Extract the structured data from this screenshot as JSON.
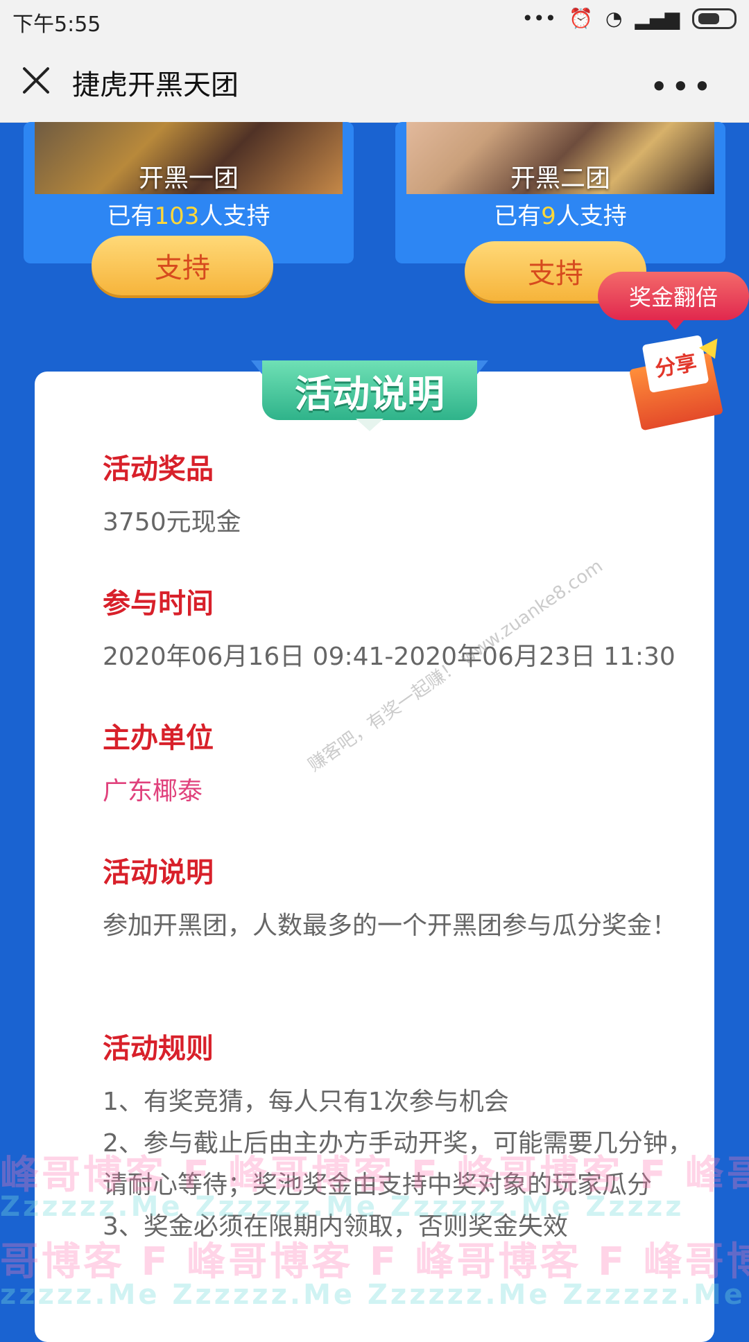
{
  "status_bar": {
    "time": "下午5:55",
    "icons": [
      "more-dots-icon",
      "alarm-icon",
      "wifi-icon",
      "hd-signal-icon",
      "battery-icon"
    ]
  },
  "header": {
    "title": "捷虎开黑天团",
    "close_icon": "close-icon",
    "more_icon": "more-icon"
  },
  "teams": [
    {
      "name": "开黑一团",
      "support_prefix": "已有",
      "count": "103",
      "support_suffix": "人支持",
      "button": "支持"
    },
    {
      "name": "开黑二团",
      "support_prefix": "已有",
      "count": "9",
      "support_suffix": "人支持",
      "button": "支持"
    }
  ],
  "bonus_badge": "奖金翻倍",
  "share_label": "分享",
  "banner": "活动说明",
  "sections": {
    "prize": {
      "title": "活动奖品",
      "body": "3750元现金"
    },
    "time": {
      "title": "参与时间",
      "body": "2020年06月16日 09:41-2020年06月23日 11:30"
    },
    "organizer": {
      "title": "主办单位",
      "body": "广东椰泰"
    },
    "desc": {
      "title": "活动说明",
      "body": "参加开黑团，人数最多的一个开黑团参与瓜分奖金！"
    },
    "rules": {
      "title": "活动规则",
      "lines": [
        "1、有奖竞猜，每人只有1次参与机会",
        "2、参与截止后由主办方手动开奖，可能需要几分钟，请耐心等待；奖池奖金由支持中奖对象的玩家瓜分",
        "3、奖金必须在限期内领取，否则奖金失效"
      ]
    }
  },
  "watermarks": {
    "diagonal": "赚客吧，有奖一起赚！ www.zuanke8.com",
    "row1": "峰哥博客  F  峰哥博客  F  峰哥博客  F  峰哥",
    "row2": "Zzzzzz.Me     Zzzzzz.Me     Zzzzzz.Me     Zzzzz",
    "row3": "哥博客  F  峰哥博客  F  峰哥博客  F  峰哥博",
    "row4": "zzzzz.Me     Zzzzzz.Me     Zzzzzz.Me     Zzzzzz.Me"
  },
  "colors": {
    "page_bg": "#1a63d1",
    "accent_red": "#d8202a",
    "gold": "#ffd83a"
  }
}
